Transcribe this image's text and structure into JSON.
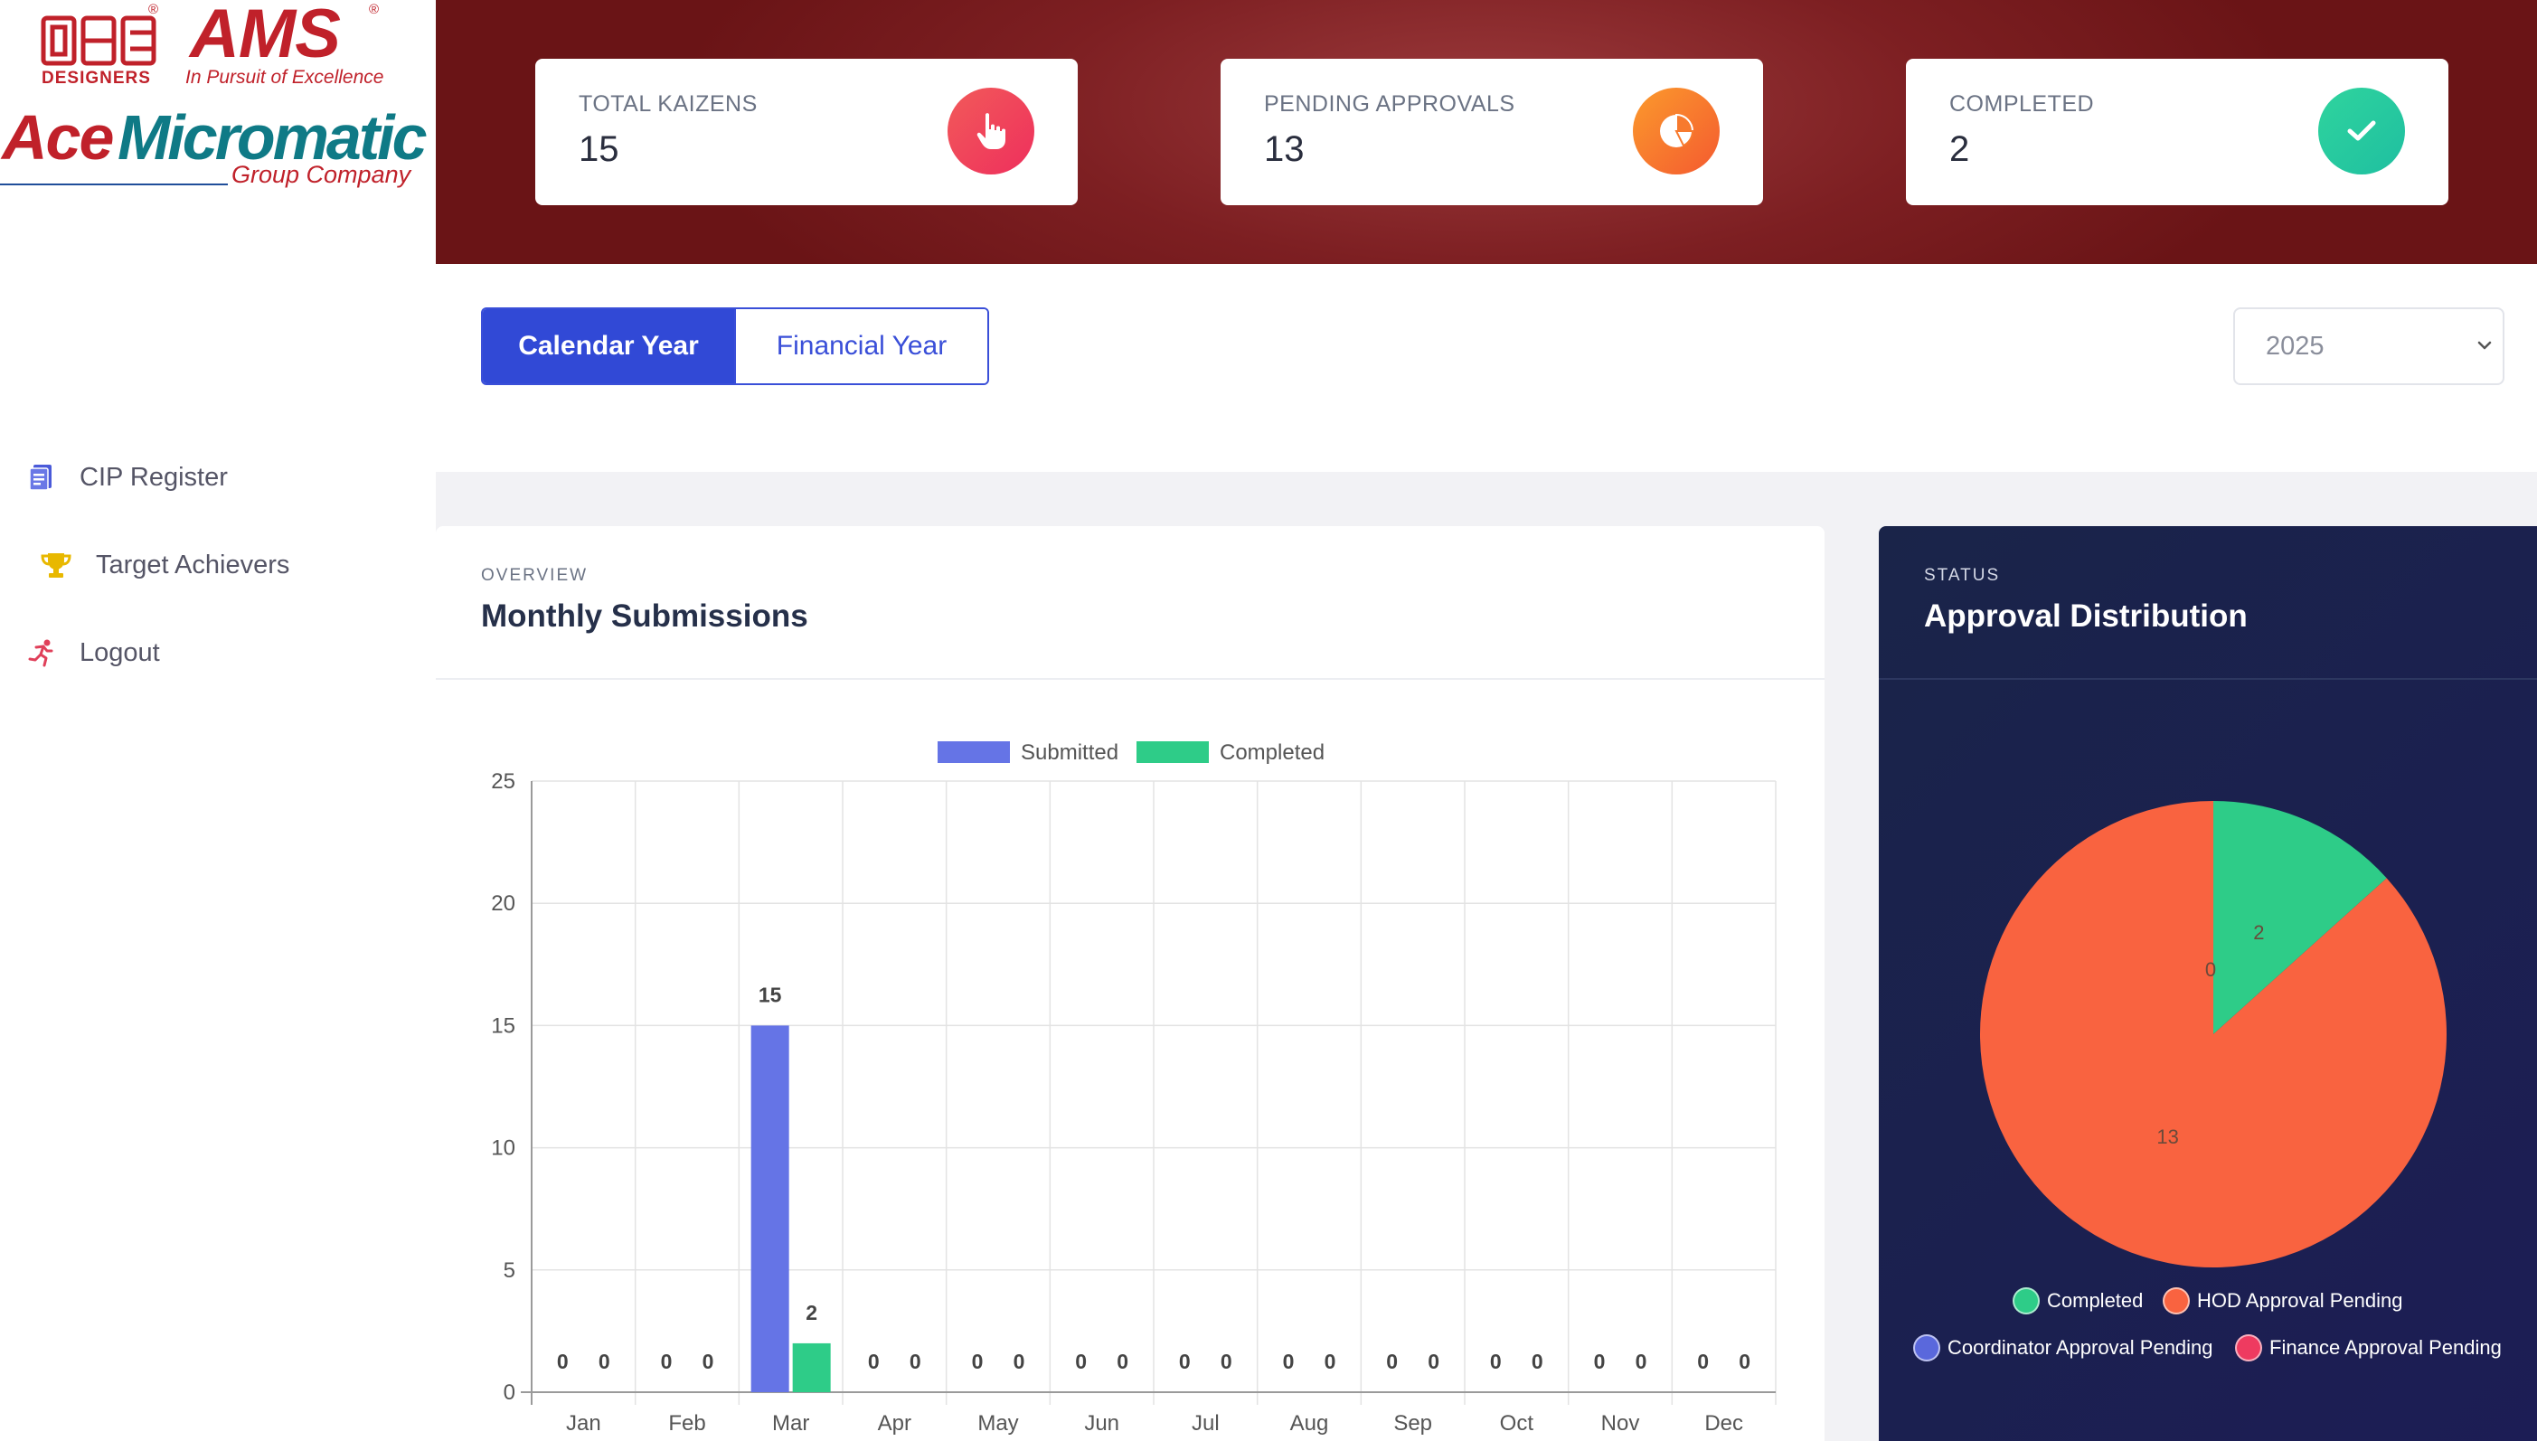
{
  "brand": {
    "ace_designers": "DESIGNERS",
    "ams": "AMS",
    "tagline": "In Pursuit of Excellence",
    "ace": "Ace",
    "micromatic": "Micromatic",
    "group_company": "Group Company",
    "registered_mark": "®",
    "colors": {
      "red": "#c0212a",
      "teal": "#0f7a86"
    }
  },
  "sidebar": {
    "items": [
      {
        "label": "CIP Register",
        "icon": "document-list-icon",
        "color": "#4a5ad9"
      },
      {
        "label": "Target Achievers",
        "icon": "trophy-icon",
        "color": "#e0b400"
      },
      {
        "label": "Logout",
        "icon": "running-person-icon",
        "color": "#e0405a"
      }
    ]
  },
  "stats": [
    {
      "title": "TOTAL KAIZENS",
      "value": "15",
      "icon": "hand-pointer-icon",
      "color": "#f0455a"
    },
    {
      "title": "PENDING APPROVALS",
      "value": "13",
      "icon": "pie-chart-icon",
      "color": "#f77a2e"
    },
    {
      "title": "COMPLETED",
      "value": "2",
      "icon": "checkmark-icon",
      "color": "#27c99a"
    }
  ],
  "filters": {
    "calendar_year": "Calendar Year",
    "financial_year": "Financial Year",
    "selected_year": "2025"
  },
  "monthly": {
    "eyebrow": "OVERVIEW",
    "title": "Monthly Submissions"
  },
  "approval": {
    "eyebrow": "STATUS",
    "title": "Approval Distribution"
  },
  "chart_data": [
    {
      "type": "bar",
      "title": "",
      "xlabel": "",
      "ylabel": "",
      "ylim": [
        0,
        25
      ],
      "yticks": [
        0,
        5,
        10,
        15,
        20,
        25
      ],
      "grid": true,
      "legend": "top",
      "categories": [
        "Jan",
        "Feb",
        "Mar",
        "Apr",
        "May",
        "Jun",
        "Jul",
        "Aug",
        "Sep",
        "Oct",
        "Nov",
        "Dec"
      ],
      "series": [
        {
          "name": "Submitted",
          "color": "#6574e6",
          "values": [
            0,
            0,
            15,
            0,
            0,
            0,
            0,
            0,
            0,
            0,
            0,
            0
          ]
        },
        {
          "name": "Completed",
          "color": "#2ecc88",
          "values": [
            0,
            0,
            2,
            0,
            0,
            0,
            0,
            0,
            0,
            0,
            0,
            0
          ]
        }
      ],
      "data_labels": true
    },
    {
      "type": "pie",
      "title": "",
      "legend": "bottom",
      "slices": [
        {
          "name": "Completed",
          "value": 2,
          "color": "#2ecc88"
        },
        {
          "name": "HOD Approval Pending",
          "value": 13,
          "color": "#f96340"
        },
        {
          "name": "Coordinator Approval Pending",
          "value": 0,
          "color": "#5a68dc"
        },
        {
          "name": "Finance Approval Pending",
          "value": 0,
          "color": "#ee3b60"
        }
      ]
    }
  ]
}
